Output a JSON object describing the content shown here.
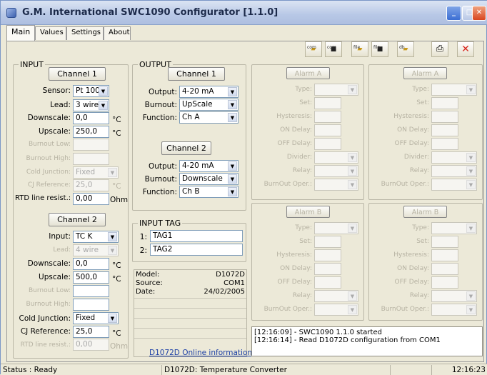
{
  "window": {
    "title": "G.M. International SWC1090 Configurator [1.1.0]"
  },
  "tabs": [
    {
      "label": "Main"
    },
    {
      "label": "Values"
    },
    {
      "label": "Settings"
    },
    {
      "label": "About"
    }
  ],
  "toolbar": {
    "comm_open_tag": "com",
    "comm_save_tag": "com",
    "file_open_tag": "file",
    "file_save_tag": "file",
    "db_open_tag": "db"
  },
  "input": {
    "title": "INPUT",
    "ch1": {
      "button": "Channel 1",
      "sensor_label": "Sensor:",
      "sensor": "Pt 100",
      "lead_label": "Lead:",
      "lead": "3 wire",
      "downscale_label": "Downscale:",
      "downscale": "0,0",
      "downscale_unit": "°C",
      "upscale_label": "Upscale:",
      "upscale": "250,0",
      "upscale_unit": "°C",
      "burnout_low_label": "Burnout Low:",
      "burnout_high_label": "Burnout High:",
      "cold_junction_label": "Cold Junction:",
      "cold_junction": "Fixed",
      "cj_reference_label": "CJ Reference:",
      "cj_reference": "25,0",
      "cj_unit": "°C",
      "rtd_label": "RTD line resist.:",
      "rtd": "0,00",
      "rtd_unit": "Ohm"
    },
    "ch2": {
      "button": "Channel 2",
      "input_label": "Input:",
      "input": "TC K",
      "lead_label": "Lead:",
      "lead": "4 wire",
      "downscale_label": "Downscale:",
      "downscale": "0,0",
      "downscale_unit": "°C",
      "upscale_label": "Upscale:",
      "upscale": "500,0",
      "upscale_unit": "°C",
      "burnout_low_label": "Burnout Low:",
      "burnout_high_label": "Burnout High:",
      "cold_junction_label": "Cold Junction:",
      "cold_junction": "Fixed",
      "cj_reference_label": "CJ Reference:",
      "cj_reference": "25,0",
      "cj_unit": "°C",
      "rtd_label": "RTD line resist.:",
      "rtd": "0,00",
      "rtd_unit": "Ohm"
    }
  },
  "output": {
    "title": "OUTPUT",
    "ch1": {
      "button": "Channel 1",
      "output_label": "Output:",
      "output": "4-20 mA",
      "burnout_label": "Burnout:",
      "burnout": "UpScale",
      "function_label": "Function:",
      "function": "Ch A"
    },
    "ch2": {
      "button": "Channel 2",
      "output_label": "Output:",
      "output": "4-20 mA",
      "burnout_label": "Burnout:",
      "burnout": "Downscale",
      "function_label": "Function:",
      "function": "Ch B"
    }
  },
  "input_tag": {
    "title": "INPUT TAG",
    "tag1_label": "1:",
    "tag1": "TAG1",
    "tag2_label": "2:",
    "tag2": "TAG2"
  },
  "alarms": {
    "alarm_a": "Alarm A",
    "alarm_b": "Alarm B",
    "type": "Type:",
    "set": "Set:",
    "hysteresis": "Hysteresis:",
    "on_delay": "ON Delay:",
    "off_delay": "OFF Delay:",
    "divider": "Divider:",
    "relay": "Relay:",
    "burnout_oper": "BurnOut Oper.:"
  },
  "device_info": {
    "model_label": "Model:",
    "model": "D1072D",
    "source_label": "Source:",
    "source": "COM1",
    "date_label": "Date:",
    "date": "24/02/2005",
    "link": "D1072D Online information"
  },
  "log": {
    "line1": "[12:16:09] - SWC1090 1.1.0 started",
    "line2": "[12:16:14] - Read D1072D configuration from COM1"
  },
  "statusbar": {
    "status": "Status : Ready",
    "device": "D1072D: Temperature Converter",
    "time": "12:16:23"
  },
  "colors": {
    "titlebar": "#c3d1ec",
    "panel": "#ece9d8",
    "link": "#1b3fa6",
    "close_icon": "#d8281f"
  }
}
